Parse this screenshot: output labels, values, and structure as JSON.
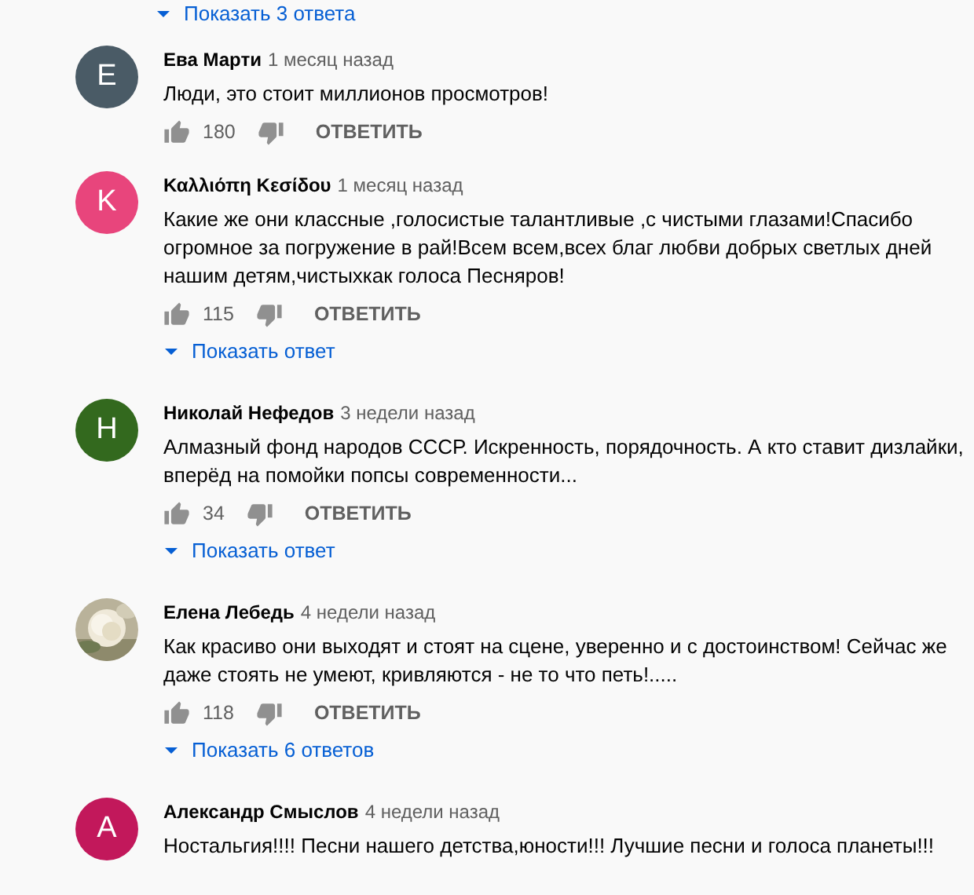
{
  "top_replies_link": "Показать 3 ответа",
  "comments": [
    {
      "avatar": {
        "kind": "letter",
        "letter": "E",
        "color": "#4a5b66"
      },
      "author": "Ева Марти",
      "time": "1 месяц назад",
      "text": "Люди, это стоит миллионов просмотров!",
      "likes": "180",
      "reply_label": "ОТВЕТИТЬ"
    },
    {
      "avatar": {
        "kind": "letter",
        "letter": "K",
        "color": "#e8457c"
      },
      "author": "Καλλιόπη Κεσίδου",
      "time": "1 месяц назад",
      "text": "Какие же они классные ,голосистые талантливые ,с чистыми глазами!Спасибо огромное за погружение в рай!Всем всем,всех благ любви добрых светлых дней нашим детям,чистыхкак голоса Песняров!",
      "likes": "115",
      "reply_label": "ОТВЕТИТЬ",
      "show_replies": "Показать ответ"
    },
    {
      "avatar": {
        "kind": "letter",
        "letter": "H",
        "color": "#33691e"
      },
      "author": "Николай Нефедов",
      "time": "3 недели назад",
      "text": "Алмазный фонд народов СССР.  Искренность, порядочность. А кто ставит дизлайки, вперёд на помойки попсы современности...",
      "likes": "34",
      "reply_label": "ОТВЕТИТЬ",
      "show_replies": "Показать ответ"
    },
    {
      "author": "Елена Лебедь",
      "time": "4 недели назад",
      "text": "Как красиво они выходят и стоят на сцене,  уверенно и с достоинством! Сейчас же даже стоять не умеют, кривляются - не то что петь!.....",
      "likes": "118",
      "reply_label": "ОТВЕТИТЬ",
      "show_replies": "Показать 6 ответов"
    },
    {
      "avatar": {
        "kind": "letter",
        "letter": "A",
        "color": "#c2185b"
      },
      "author": "Александр Смыслов",
      "time": "4 недели назад",
      "text": "Ностальгия!!!! Песни нашего детства,юности!!! Лучшие песни и голоса планеты!!!"
    }
  ]
}
